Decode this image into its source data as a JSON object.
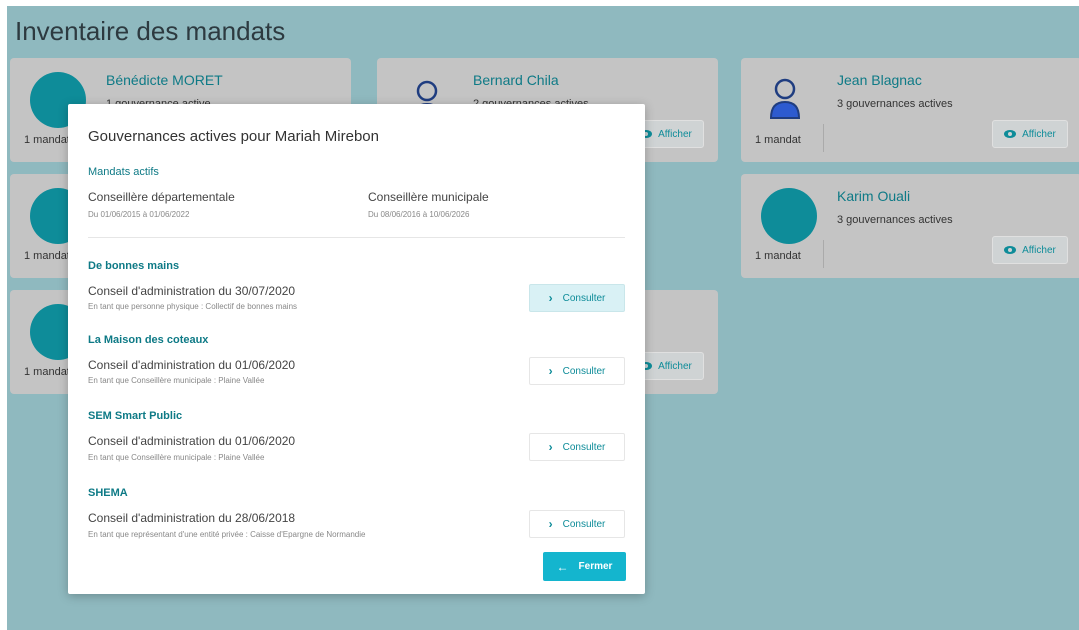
{
  "page": {
    "title": "Inventaire des mandats",
    "afficher_label": "Afficher",
    "cards": [
      {
        "name": "Bénédicte MORET",
        "gov": "1 gouvernance active",
        "mandat": "1 mandat"
      },
      {
        "name": "Bernard Chila",
        "gov": "2 gouvernances actives",
        "mandat": ""
      },
      {
        "name": "Jean Blagnac",
        "gov": "3 gouvernances actives",
        "mandat": "1 mandat"
      },
      {
        "name": "",
        "gov": "",
        "mandat": "1 mandat"
      },
      {
        "name": "Karim Ouali",
        "gov": "3 gouvernances actives",
        "mandat": "1 mandat"
      },
      {
        "name": "",
        "gov": "",
        "mandat": "1 mandat"
      }
    ]
  },
  "modal": {
    "title": "Gouvernances actives pour Mariah Mirebon",
    "mandats_label": "Mandats actifs",
    "mandats": [
      {
        "name": "Conseillère départementale",
        "dates": "Du 01/06/2015 à 01/06/2022"
      },
      {
        "name": "Conseillère municipale",
        "dates": "Du 08/06/2016 à 10/06/2026"
      }
    ],
    "consulter_label": "Consulter",
    "gouvernances": [
      {
        "org": "De bonnes mains",
        "title": "Conseil d'administration du 30/07/2020",
        "sub": "En tant que personne physique : Collectif de bonnes mains"
      },
      {
        "org": "La Maison des coteaux",
        "title": "Conseil d'administration du 01/06/2020",
        "sub": "En tant que Conseillère municipale : Plaine Vallée"
      },
      {
        "org": "SEM Smart Public",
        "title": "Conseil d'administration du 01/06/2020",
        "sub": "En tant que Conseillère municipale : Plaine Vallée"
      },
      {
        "org": "SHEMA",
        "title": "Conseil d'administration du 28/06/2018",
        "sub": "En tant que représentant d'une entité privée : Caisse d'Epargne de Normandie"
      }
    ],
    "fermer_label": "Fermer"
  }
}
